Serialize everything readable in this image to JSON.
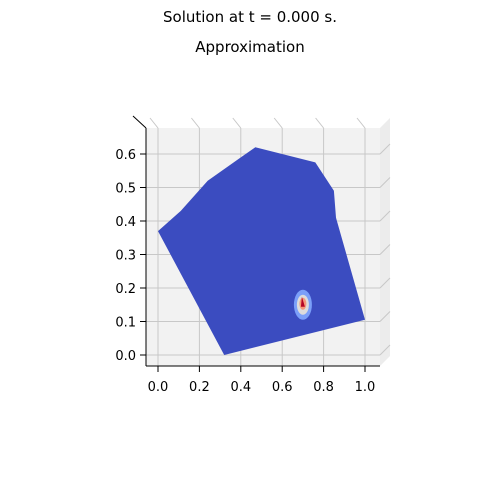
{
  "figure": {
    "suptitle": "Solution at t = 0.000 s.",
    "subtitle": "Approximation"
  },
  "chart_data": {
    "type": "heatmap",
    "projection": "3d surface viewed from top",
    "title": "Approximation",
    "xlabel": "",
    "ylabel": "",
    "xlim": [
      -0.05,
      1.07
    ],
    "ylim": [
      -0.03,
      0.66
    ],
    "x_ticks": [
      "0.0",
      "0.2",
      "0.4",
      "0.6",
      "0.8",
      "1.0"
    ],
    "x_tick_values": [
      0.0,
      0.2,
      0.4,
      0.6,
      0.8,
      1.0
    ],
    "y_ticks": [
      "0.0",
      "0.1",
      "0.2",
      "0.3",
      "0.4",
      "0.5",
      "0.6"
    ],
    "y_tick_values": [
      0.0,
      0.1,
      0.2,
      0.3,
      0.4,
      0.5,
      0.6
    ],
    "grid": true,
    "colormap": "coolwarm",
    "colors": {
      "surface": "#3b4cc0",
      "pane": "#f2f2f2",
      "grid": "#c8c8c8",
      "hot": "#b40426",
      "warm": "#f4987a",
      "mid": "#dddcdc",
      "cool": "#7b9ff9"
    },
    "domain_polygon": [
      [
        0.0,
        0.37
      ],
      [
        0.11,
        0.43
      ],
      [
        0.24,
        0.52
      ],
      [
        0.4,
        0.59
      ],
      [
        0.47,
        0.62
      ],
      [
        0.76,
        0.575
      ],
      [
        0.85,
        0.49
      ],
      [
        0.86,
        0.41
      ],
      [
        1.0,
        0.105
      ],
      [
        0.32,
        0.0
      ]
    ],
    "peak": {
      "x": 0.7,
      "y": 0.15,
      "value_level": "max"
    }
  }
}
